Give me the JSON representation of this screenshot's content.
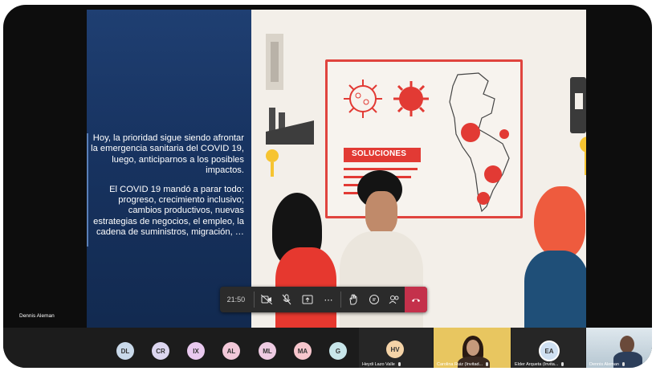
{
  "slide": {
    "paragraph1": "Hoy, la prioridad sigue siendo afrontar la emergencia sanitaria del COVID 19, luego, anticiparnos a los posibles impactos.",
    "paragraph2": "El COVID 19 mandó a parar todo: progreso, crecimiento inclusivo; cambios productivos, nuevas estrategias de negocios, el empleo, la cadena de suministros, migración, …",
    "board_title": "SOLUCIONES"
  },
  "presenter_label": "Dennis Aleman",
  "toolbar": {
    "time": "21:50",
    "buttons": [
      "camera-off-icon",
      "mic-off-icon",
      "share-screen-icon",
      "more-icon",
      "raise-hand-icon",
      "chat-icon",
      "participants-icon"
    ],
    "hangup_color": "#c4314b"
  },
  "participants": [
    {
      "initials": "DL",
      "color": "#c9d9ea"
    },
    {
      "initials": "CR",
      "color": "#dcd6f0"
    },
    {
      "initials": "IX",
      "color": "#e9c9ef"
    },
    {
      "initials": "AL",
      "color": "#f2c8d9"
    },
    {
      "initials": "ML",
      "color": "#eecbe2"
    },
    {
      "initials": "MA",
      "color": "#f7c6cd"
    },
    {
      "initials": "G",
      "color": "#c8e6ea"
    }
  ],
  "tiles": [
    {
      "initials": "HV",
      "name": "Heydi Lazo Valle",
      "color": "#f4d3a7"
    },
    {
      "name": "Carolina Ruiz (Invitad..."
    },
    {
      "initials": "EA",
      "name": "Elder Arqueta (Invita...",
      "color": "#cfe0f2"
    },
    {
      "name": "Dennis Aleman"
    }
  ]
}
